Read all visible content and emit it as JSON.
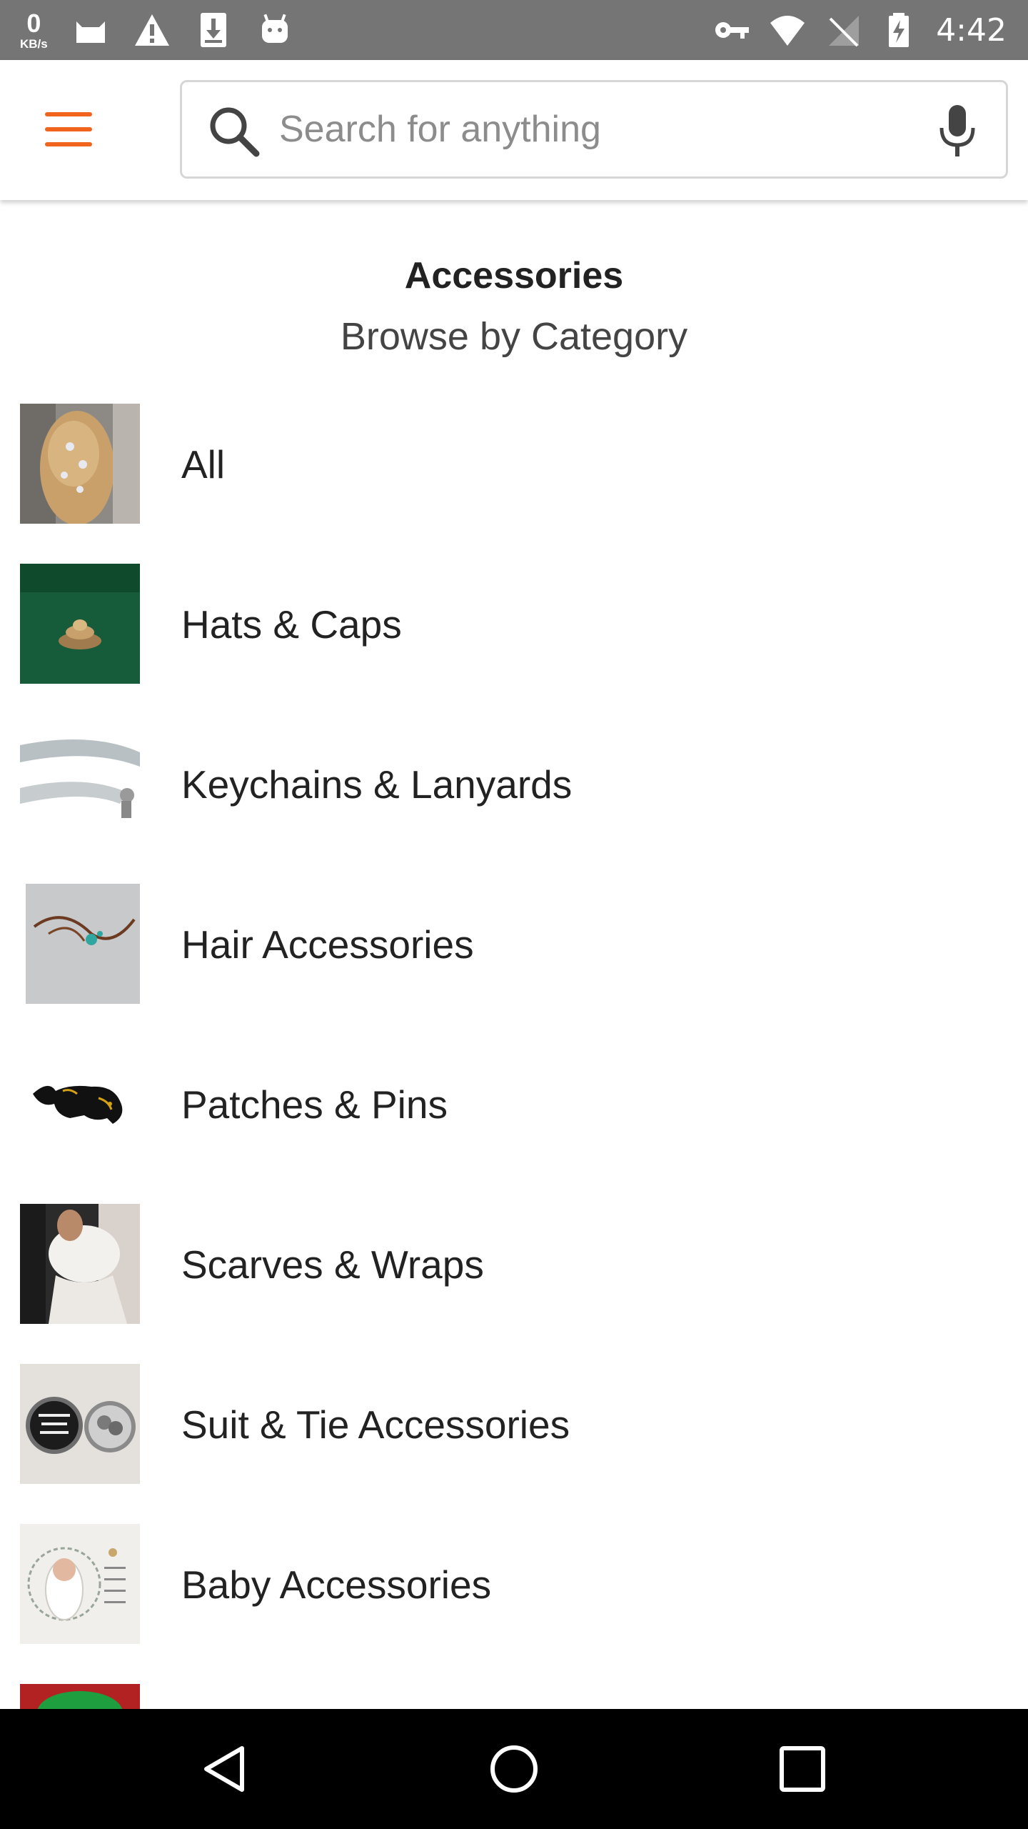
{
  "status_bar": {
    "net_speed_value": "0",
    "net_speed_unit": "KB/s",
    "time": "4:42",
    "icons_left": [
      "cat-icon",
      "warning-icon",
      "download-icon",
      "android-icon"
    ],
    "icons_right": [
      "key-icon",
      "wifi-icon",
      "no-signal-icon",
      "battery-charging-icon"
    ]
  },
  "app_bar": {
    "menu_icon": "hamburger-menu-icon",
    "search_placeholder": "Search for anything",
    "search_value": "",
    "search_icon": "search-icon",
    "mic_icon": "microphone-icon"
  },
  "page": {
    "title": "Accessories",
    "subtitle": "Browse by Category"
  },
  "categories": [
    {
      "label": "All",
      "image": "braided-hair-with-jeweled-pins"
    },
    {
      "label": "Hats & Caps",
      "image": "gold-ornament-on-green-felt"
    },
    {
      "label": "Keychains & Lanyards",
      "image": "grey-lanyard-with-clip"
    },
    {
      "label": "Hair Accessories",
      "image": "wire-hair-vine-tiara"
    },
    {
      "label": "Patches & Pins",
      "image": "black-panther-patch"
    },
    {
      "label": "Scarves & Wraps",
      "image": "white-fur-bridal-wrap"
    },
    {
      "label": "Suit & Tie Accessories",
      "image": "photo-cufflinks"
    },
    {
      "label": "Baby Accessories",
      "image": "baby-milestone-blanket"
    },
    {
      "label": "",
      "image": "partially-visible-green-item"
    }
  ],
  "colors": {
    "accent": "#F1641E",
    "status_bar": "#757575",
    "nav_bar": "#000000"
  },
  "nav_bar": {
    "back_icon": "back-triangle-icon",
    "home_icon": "home-circle-icon",
    "recents_icon": "recents-square-icon"
  }
}
